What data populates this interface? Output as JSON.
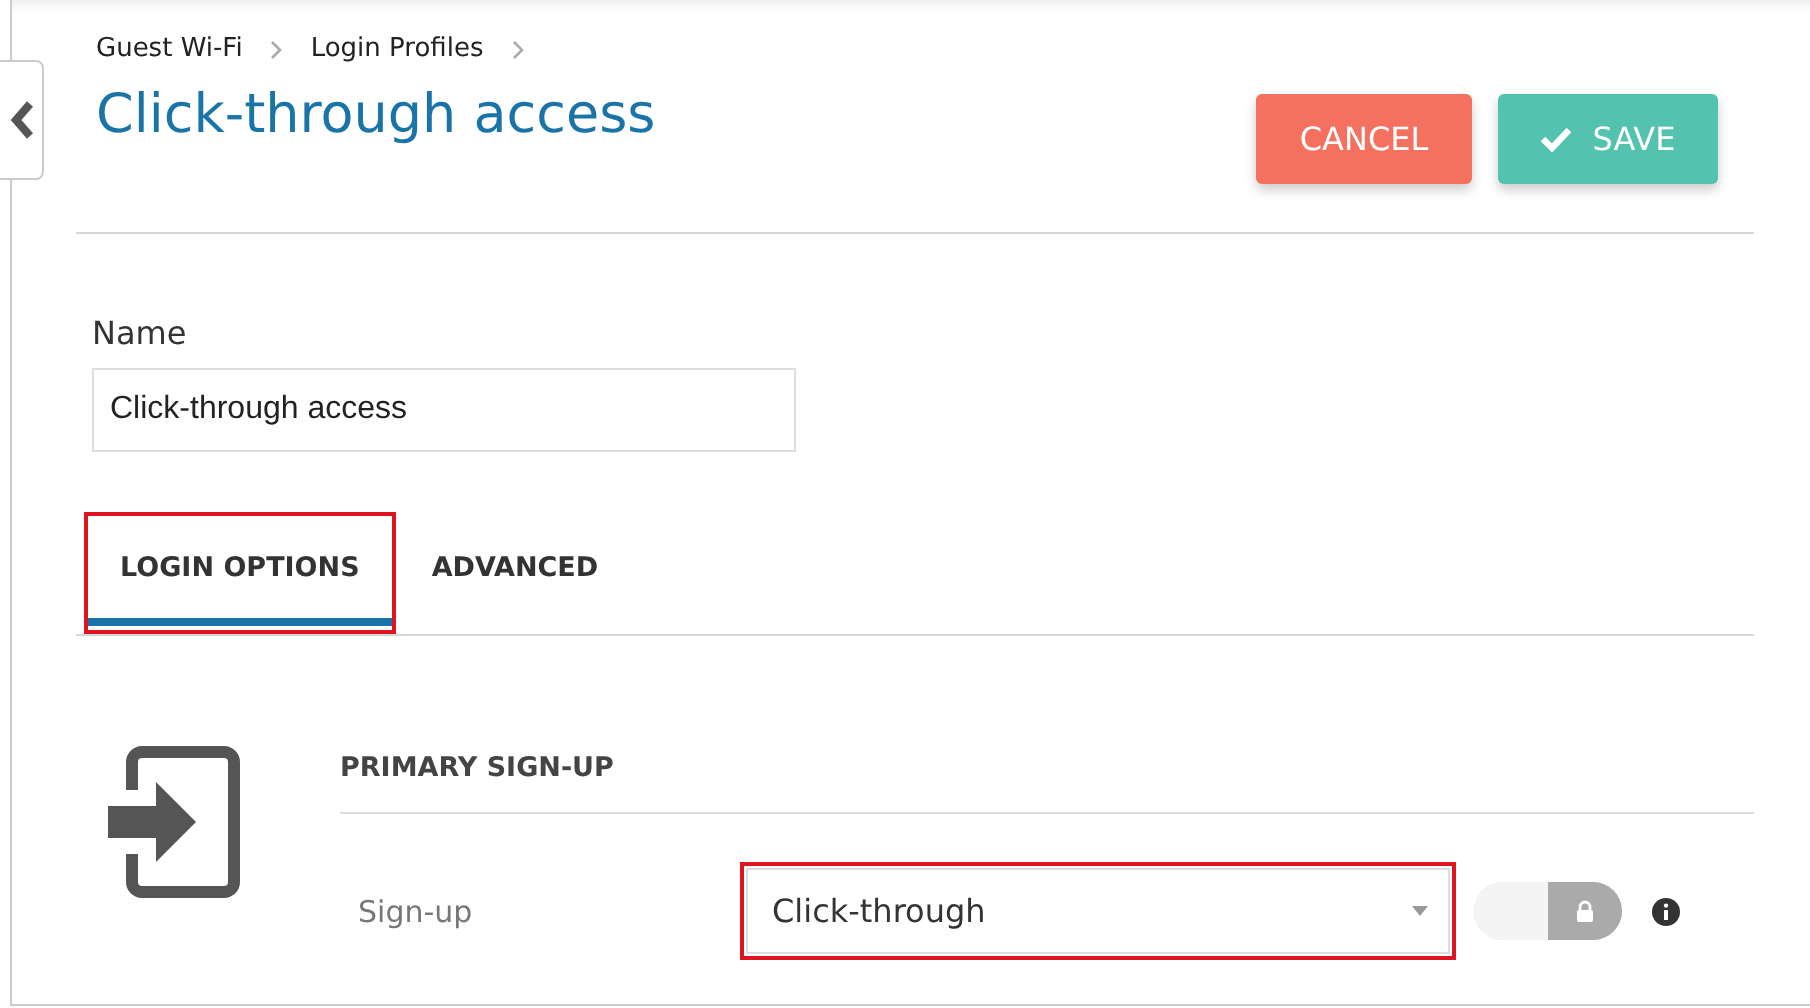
{
  "breadcrumb": [
    "Guest Wi-Fi",
    "Login Profiles"
  ],
  "title": "Click-through access",
  "buttons": [
    {
      "kind": "cancel",
      "label": "CANCEL"
    },
    {
      "kind": "save",
      "label": "SAVE"
    }
  ],
  "name_field": {
    "label": "Name",
    "value": "Click-through access"
  },
  "tabs": [
    {
      "label": "LOGIN OPTIONS",
      "selected": true,
      "highlighted": true
    },
    {
      "label": "ADVANCED",
      "selected": false,
      "highlighted": false
    }
  ],
  "section": {
    "heading": "PRIMARY SIGN-UP",
    "field_label": "Sign-up",
    "select_value": "Click-through",
    "select_highlighted": true,
    "locked": true
  }
}
